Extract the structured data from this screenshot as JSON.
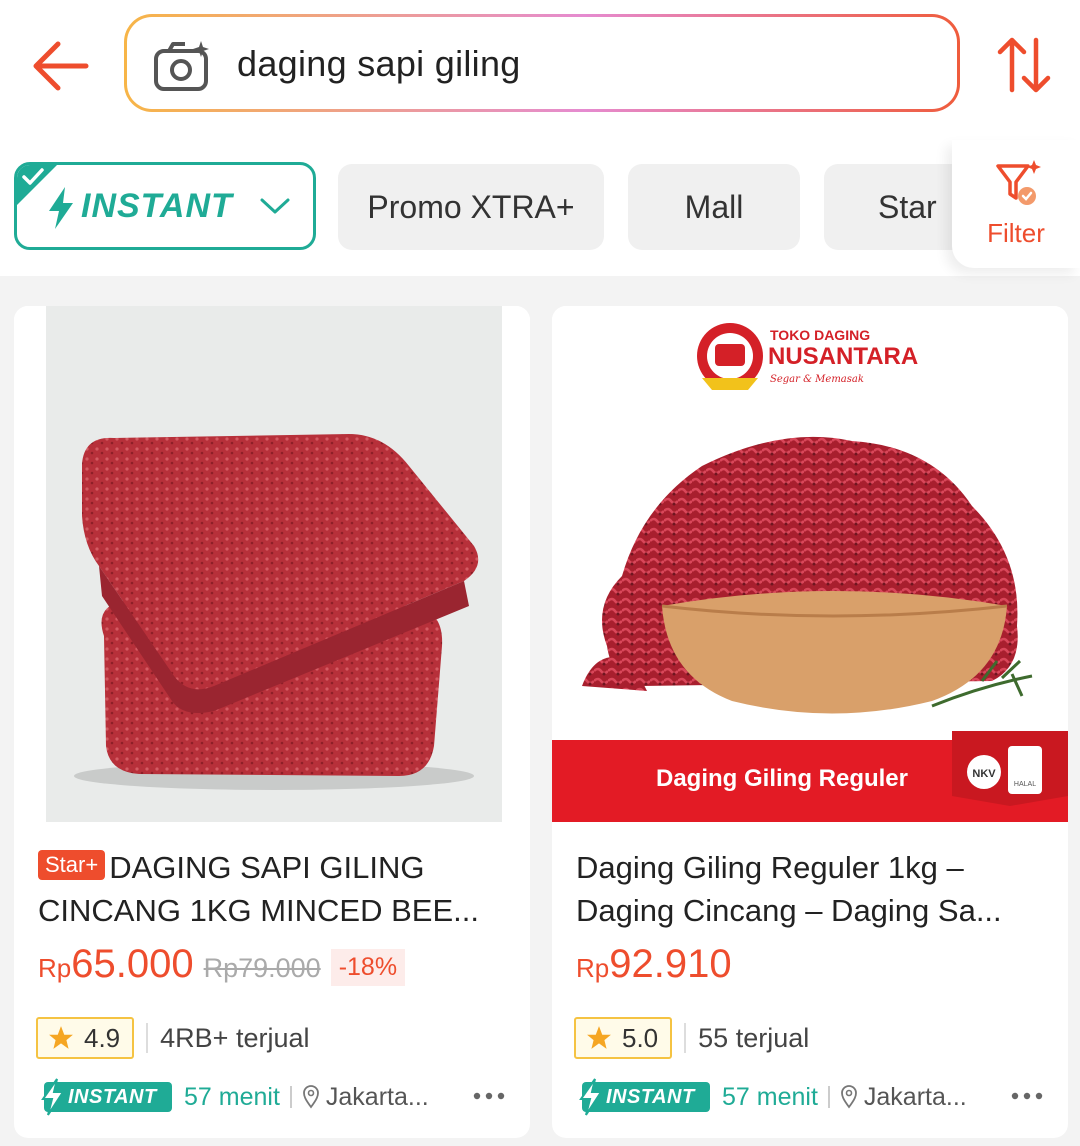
{
  "search": {
    "query": "daging sapi giling"
  },
  "filters": {
    "instant_label": "INSTANT",
    "chips": [
      "Promo XTRA+",
      "Mall",
      "Star"
    ],
    "filter_label": "Filter"
  },
  "products": [
    {
      "badge": "Star+",
      "title": "DAGING SAPI GILING CINCANG 1KG MINCED BEE...",
      "currency": "Rp",
      "price": "65.000",
      "original_price": "Rp79.000",
      "discount": "-18%",
      "rating": "4.9",
      "sold": "4RB+ terjual",
      "instant_label": "INSTANT",
      "eta": "57 menit",
      "location": "Jakarta..."
    },
    {
      "title": "Daging Giling Reguler 1kg – Daging Cincang – Daging Sa...",
      "currency": "Rp",
      "price": "92.910",
      "rating": "5.0",
      "sold": "55 terjual",
      "instant_label": "INSTANT",
      "eta": "57 menit",
      "location": "Jakarta...",
      "image_text": {
        "store_small": "TOKO DAGING",
        "store_name": "NUSANTARA",
        "store_tagline": "Segar & Memasak",
        "banner": "Daging Giling Reguler",
        "nkv": "NKV",
        "halal": "HALAL"
      }
    }
  ],
  "colors": {
    "accent": "#ee4d2d",
    "instant": "#1fab96",
    "rating": "#f5c342"
  }
}
